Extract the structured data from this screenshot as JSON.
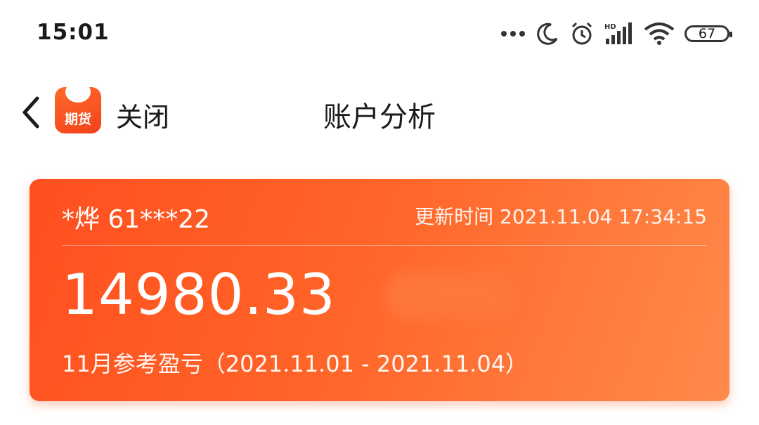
{
  "status_bar": {
    "time": "15:01",
    "icons": [
      "more-dots-icon",
      "moon-icon",
      "alarm-icon",
      "signal-icon",
      "wifi-icon",
      "battery-icon"
    ],
    "battery_level": "67",
    "signal_label": "HD"
  },
  "nav": {
    "logo_text": "期货",
    "close_label": "关闭",
    "title": "账户分析"
  },
  "card": {
    "account_name": "*烨 61***22",
    "update_time": "更新时间 2021.11.04 17:34:15",
    "pnl_value": "14980.33",
    "period_text": "11月参考盈亏（2021.11.01 - 2021.11.04）",
    "colors": {
      "gradient_start": "#ff4f1f",
      "gradient_end": "#ff8a4a"
    }
  }
}
